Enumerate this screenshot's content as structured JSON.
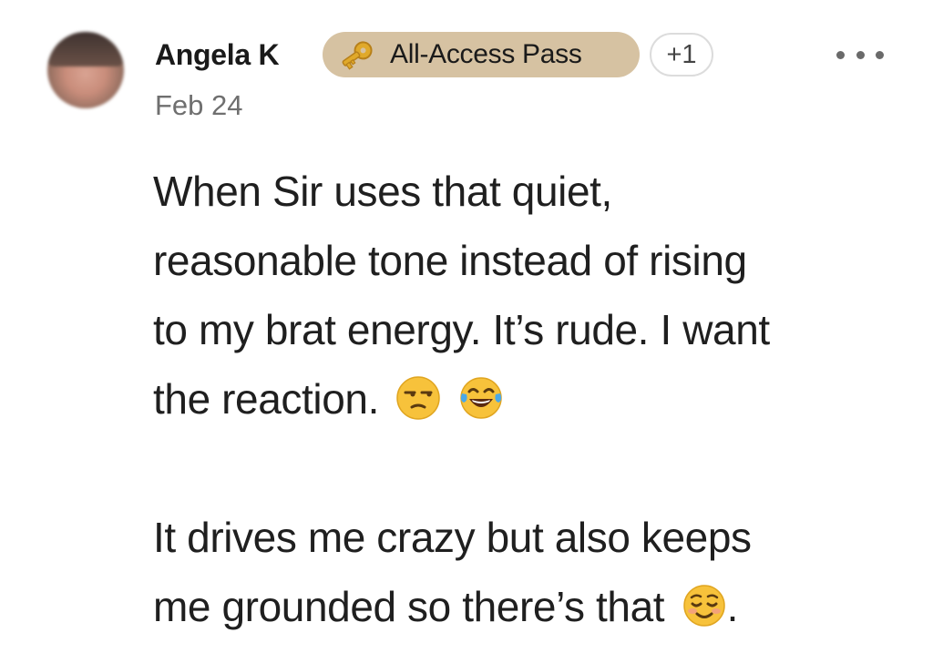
{
  "post": {
    "author": "Angela K",
    "badge": {
      "label": "All-Access Pass",
      "icon": "key-icon",
      "color": "#d6c2a2"
    },
    "extra_badges": "+1",
    "date": "Feb 24",
    "menu_icon": "more-options-icon",
    "lines": {
      "l1": "When Sir uses that quiet,",
      "l2": "reasonable tone instead of rising",
      "l3": "to my brat energy. It’s rude. I want",
      "l4": "the reaction.",
      "l5": "It drives me crazy but also keeps",
      "l6": "me grounded so there’s that",
      "l6_end": "."
    },
    "emojis": [
      "unamused-face-emoji",
      "tears-of-joy-emoji",
      "smiling-face-emoji"
    ]
  }
}
